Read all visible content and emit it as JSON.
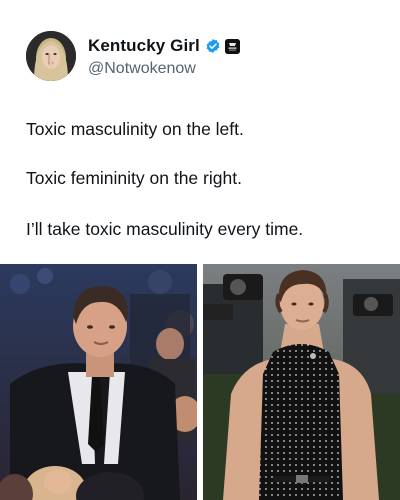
{
  "post": {
    "author": {
      "display_name": "Kentucky Girl",
      "handle": "@Notwokenow",
      "avatar_icon": "profile-avatar",
      "verified_icon": "verified-badge-icon",
      "affiliation_icon": "affiliation-badge-icon"
    },
    "text_lines": [
      "Toxic masculinity on the left.",
      "Toxic femininity on the right.",
      "I’ll take toxic masculinity every time."
    ],
    "media": [
      {
        "kind": "photo",
        "subject": "man-in-dark-suit-at-event"
      },
      {
        "kind": "photo",
        "subject": "man-in-polka-dot-halter-top-with-photographers"
      }
    ]
  },
  "colors": {
    "text_primary": "#0f1419",
    "text_secondary": "#536471",
    "verified_blue": "#1d9bf0",
    "background": "#ffffff"
  }
}
